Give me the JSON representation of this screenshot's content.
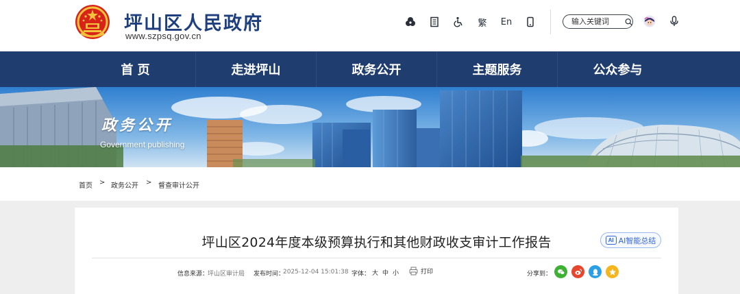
{
  "header": {
    "site_title": "坪山区人民政府",
    "site_url": "www.szpsq.gov.cn",
    "tools": {
      "font_label": "繁",
      "lang_label": "En"
    },
    "search": {
      "placeholder": "输入关键词"
    }
  },
  "nav": {
    "items": [
      {
        "label": "首 页"
      },
      {
        "label": "走进坪山"
      },
      {
        "label": "政务公开"
      },
      {
        "label": "主题服务"
      },
      {
        "label": "公众参与"
      }
    ]
  },
  "banner": {
    "title": "政务公开",
    "subtitle": "Government publishing"
  },
  "breadcrumb": {
    "items": [
      "首页",
      "政务公开",
      "督查审计公开"
    ],
    "separator": ">"
  },
  "article": {
    "title": "坪山区2024年度本级预算执行和其他财政收支审计工作报告",
    "ai_button": {
      "mark": "AI",
      "label": "AI智能总结"
    },
    "meta": {
      "source_label": "信息来源：",
      "source_value": "坪山区审计局",
      "time_label": "发布时间：",
      "time_value": "2025-12-04 15:01:38",
      "font_label": "字体：",
      "font_large": "大",
      "font_medium": "中",
      "font_small": "小",
      "print_label": "打印",
      "share_label": "分享到："
    }
  },
  "colors": {
    "brand": "#1d3f7e",
    "nav_bg": "#1f3d6e",
    "wechat": "#3eb135",
    "weibo": "#e6462e",
    "qq": "#2a9fe6",
    "qzone": "#f5b51c"
  },
  "icons": [
    "emblem-icon",
    "accessibility-icon",
    "doc-icon",
    "wheelchair-icon",
    "mobile-icon",
    "search-icon",
    "avatar-icon",
    "mic-icon",
    "print-icon",
    "wechat-icon",
    "weibo-icon",
    "qq-icon",
    "qzone-icon"
  ]
}
